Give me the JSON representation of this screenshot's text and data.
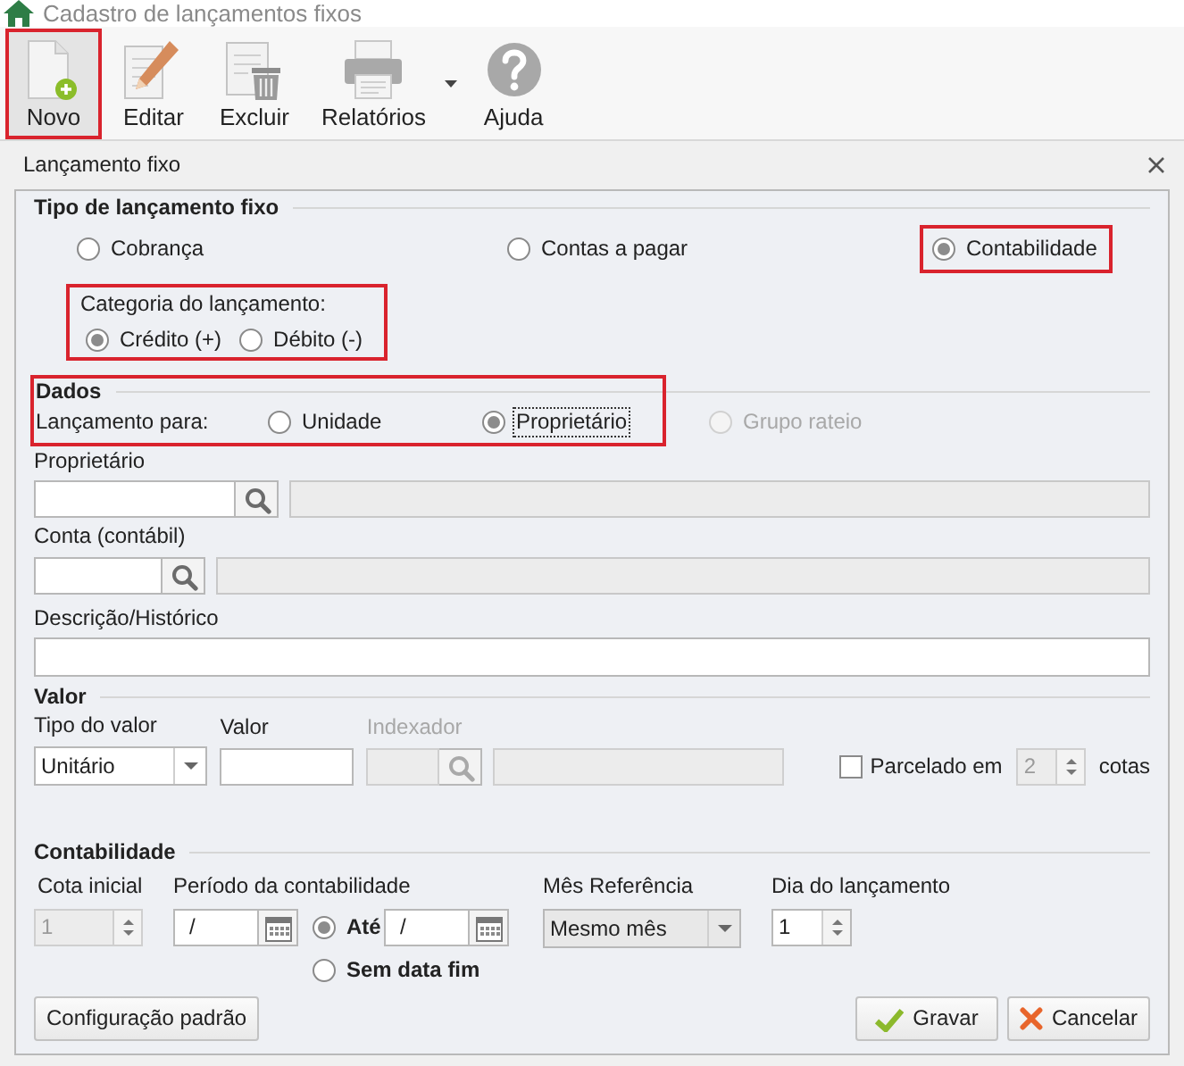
{
  "window": {
    "title": "Cadastro de lançamentos fixos"
  },
  "toolbar": [
    {
      "kind": "new",
      "label": "Novo",
      "highlighted": true
    },
    {
      "kind": "edit",
      "label": "Editar",
      "highlighted": false
    },
    {
      "kind": "delete",
      "label": "Excluir",
      "highlighted": false
    },
    {
      "kind": "print",
      "label": "Relatórios",
      "highlighted": false,
      "has_menu": true
    },
    {
      "kind": "help",
      "label": "Ajuda",
      "highlighted": false
    }
  ],
  "dialog": {
    "title": "Lançamento fixo"
  },
  "tipo": {
    "heading": "Tipo de lançamento fixo",
    "options": [
      {
        "label": "Cobrança",
        "selected": false,
        "highlighted": false
      },
      {
        "label": "Contas a pagar",
        "selected": false,
        "highlighted": false
      },
      {
        "label": "Contabilidade",
        "selected": true,
        "highlighted": true
      }
    ],
    "categoria": {
      "label": "Categoria do lançamento:",
      "highlighted": true,
      "options": [
        {
          "label": "Crédito (+)",
          "selected": true
        },
        {
          "label": "Débito (-)",
          "selected": false
        }
      ]
    }
  },
  "dados": {
    "heading": "Dados",
    "highlighted": true,
    "lancamento_para": {
      "label": "Lançamento para:",
      "options": [
        {
          "label": "Unidade",
          "selected": false,
          "disabled": false,
          "focused": false
        },
        {
          "label": "Proprietário",
          "selected": true,
          "disabled": false,
          "focused": true
        },
        {
          "label": "Grupo rateio",
          "selected": false,
          "disabled": true,
          "focused": false
        }
      ]
    },
    "proprietario": {
      "label": "Proprietário"
    },
    "conta": {
      "label": "Conta (contábil)"
    },
    "descricao": {
      "label": "Descrição/Histórico"
    }
  },
  "valor": {
    "heading": "Valor",
    "tipo_do_valor": {
      "label": "Tipo do valor",
      "value": "Unitário"
    },
    "valor": {
      "label": "Valor"
    },
    "indexador": {
      "label": "Indexador",
      "disabled": true
    },
    "parcelado": {
      "label": "Parcelado em",
      "checked": false,
      "value": "2",
      "suffix": "cotas"
    }
  },
  "contabilidade": {
    "heading": "Contabilidade",
    "cota_inicial": {
      "label": "Cota inicial",
      "value": "1",
      "disabled": true
    },
    "periodo": {
      "label": "Período da contabilidade",
      "start": "/",
      "end_options": [
        {
          "label": "Até",
          "selected": true,
          "value": "/"
        },
        {
          "label": "Sem data fim",
          "selected": false
        }
      ]
    },
    "mes_referencia": {
      "label": "Mês Referência",
      "value": "Mesmo mês"
    },
    "dia": {
      "label": "Dia do lançamento",
      "value": "1"
    }
  },
  "buttons": [
    {
      "kind": "plain",
      "label": "Configuração padrão"
    },
    {
      "kind": "save",
      "label": "Gravar"
    },
    {
      "kind": "cancel",
      "label": "Cancelar"
    }
  ]
}
